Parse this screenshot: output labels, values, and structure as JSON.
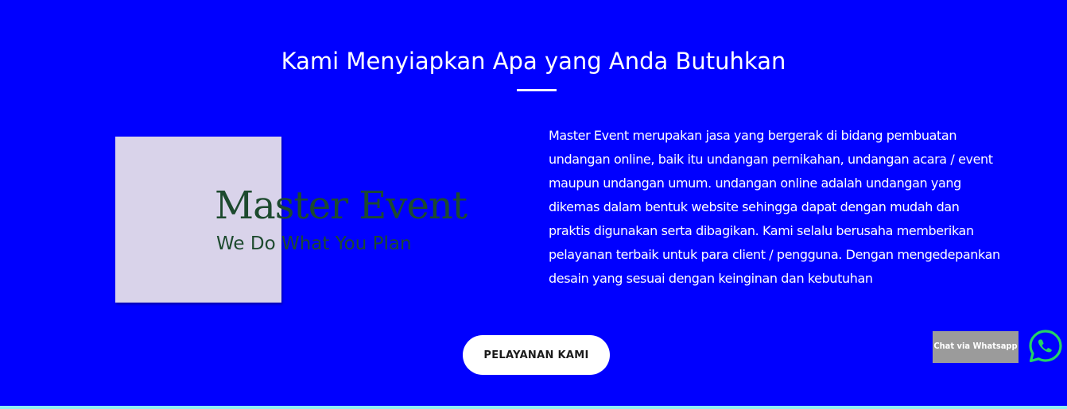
{
  "section": {
    "title": "Kami Menyiapkan Apa yang Anda Butuhkan",
    "description": "Master Event merupakan jasa yang bergerak di bidang pembuatan undangan online, baik itu undangan pernikahan, undangan acara / event maupun undangan umum. undangan online adalah undangan yang dikemas dalam bentuk website sehingga dapat dengan mudah dan praktis digunakan serta dibagikan. Kami selalu berusaha memberikan pelayanan terbaik untuk para client / pengguna. Dengan mengedepankan desain yang sesuai dengan keinginan dan kebutuhan",
    "cta_label": "PELAYANAN KAMI"
  },
  "logo": {
    "title": "Master Event",
    "tagline": "We Do What You Plan"
  },
  "whatsapp": {
    "label": "Chat via Whatsapp",
    "icon": "whatsapp-icon"
  },
  "colors": {
    "background": "#0000ff",
    "text": "#ffffff",
    "logo_box": "#d9d3ea",
    "logo_text": "#1d4a2e",
    "whatsapp_green": "#25d366",
    "whatsapp_label_bg": "#9b9b9b",
    "bottom_line": "#8ef0f5"
  }
}
